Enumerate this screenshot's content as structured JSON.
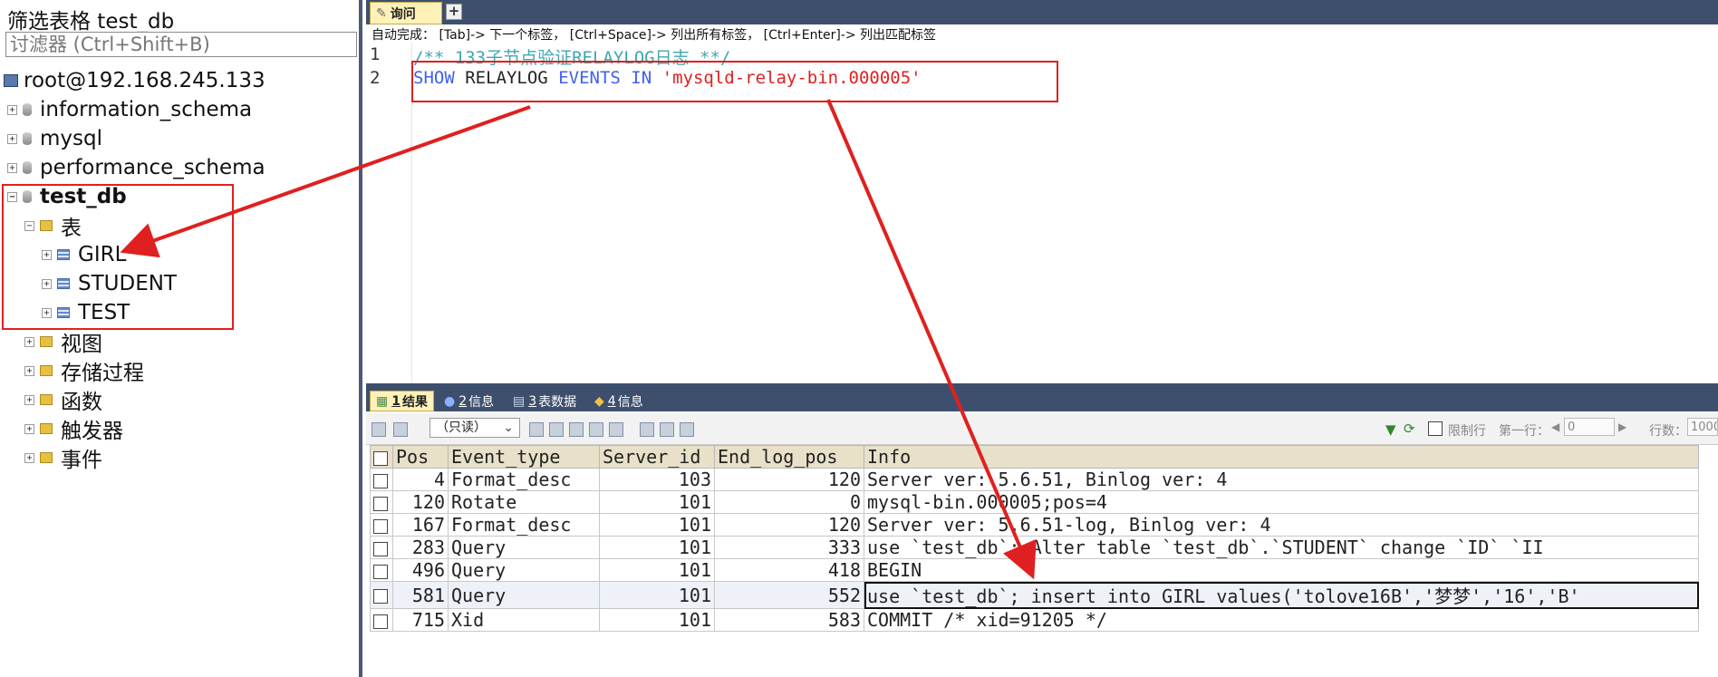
{
  "sidebar": {
    "title": "筛选表格 test_db",
    "filter_placeholder": "讨滤器 (Ctrl+Shift+B)",
    "connection": "root@192.168.245.133",
    "databases": [
      "information_schema",
      "mysql",
      "performance_schema"
    ],
    "current_db": "test_db",
    "tables_folder": "表",
    "tables": [
      "GIRL",
      "STUDENT",
      "TEST"
    ],
    "folders": [
      "视图",
      "存储过程",
      "函数",
      "触发器",
      "事件"
    ]
  },
  "editor": {
    "tab_label": "询问",
    "add_tab": "+",
    "autocomplete_hint": "自动完成： [Tab]-> 下一个标签， [Ctrl+Space]-> 列出所有标签， [Ctrl+Enter]-> 列出匹配标签",
    "line_numbers": [
      "1",
      "2"
    ],
    "line1": "/** 133子节点验证RELAYLOG日志 **/",
    "line2_kw1": "SHOW",
    "line2_plain": "RELAYLOG",
    "line2_kw2": "EVENTS",
    "line2_kw3": "IN",
    "line2_str": "'mysqld-relay-bin.000005'"
  },
  "results": {
    "tabs": [
      {
        "num": "1",
        "label": "结果"
      },
      {
        "num": "2",
        "label": "信息"
      },
      {
        "num": "3",
        "label": "表数据"
      },
      {
        "num": "4",
        "label": "信息"
      }
    ],
    "readonly_label": "（只读）",
    "limit_label": "限制行",
    "first_row_label": "第一行：",
    "first_row_value": "0",
    "rows_label": "行数：",
    "rows_value": "1000",
    "columns": [
      "Pos",
      "Event_type",
      "Server_id",
      "End_log_pos",
      "Info"
    ],
    "rows": [
      [
        "4",
        "Format_desc",
        "103",
        "120",
        "Server ver: 5.6.51, Binlog ver: 4"
      ],
      [
        "120",
        "Rotate",
        "101",
        "0",
        "mysql-bin.000005;pos=4"
      ],
      [
        "167",
        "Format_desc",
        "101",
        "120",
        "Server ver: 5.6.51-log, Binlog ver: 4"
      ],
      [
        "283",
        "Query",
        "101",
        "333",
        "use `test_db`; Alter table `test_db`.`STUDENT`     change `ID` `II"
      ],
      [
        "496",
        "Query",
        "101",
        "418",
        "BEGIN"
      ],
      [
        "581",
        "Query",
        "101",
        "552",
        "use `test_db`; insert into GIRL values('tolove16B','梦梦','16','B'"
      ],
      [
        "715",
        "Xid",
        "101",
        "583",
        "COMMIT /* xid=91205 */"
      ]
    ]
  },
  "colors": {
    "annotation": "#e02020",
    "keyword": "#3f5ff0",
    "string": "#e02020",
    "comment": "#3fa8b0",
    "panel_dark": "#3e4f6e"
  }
}
